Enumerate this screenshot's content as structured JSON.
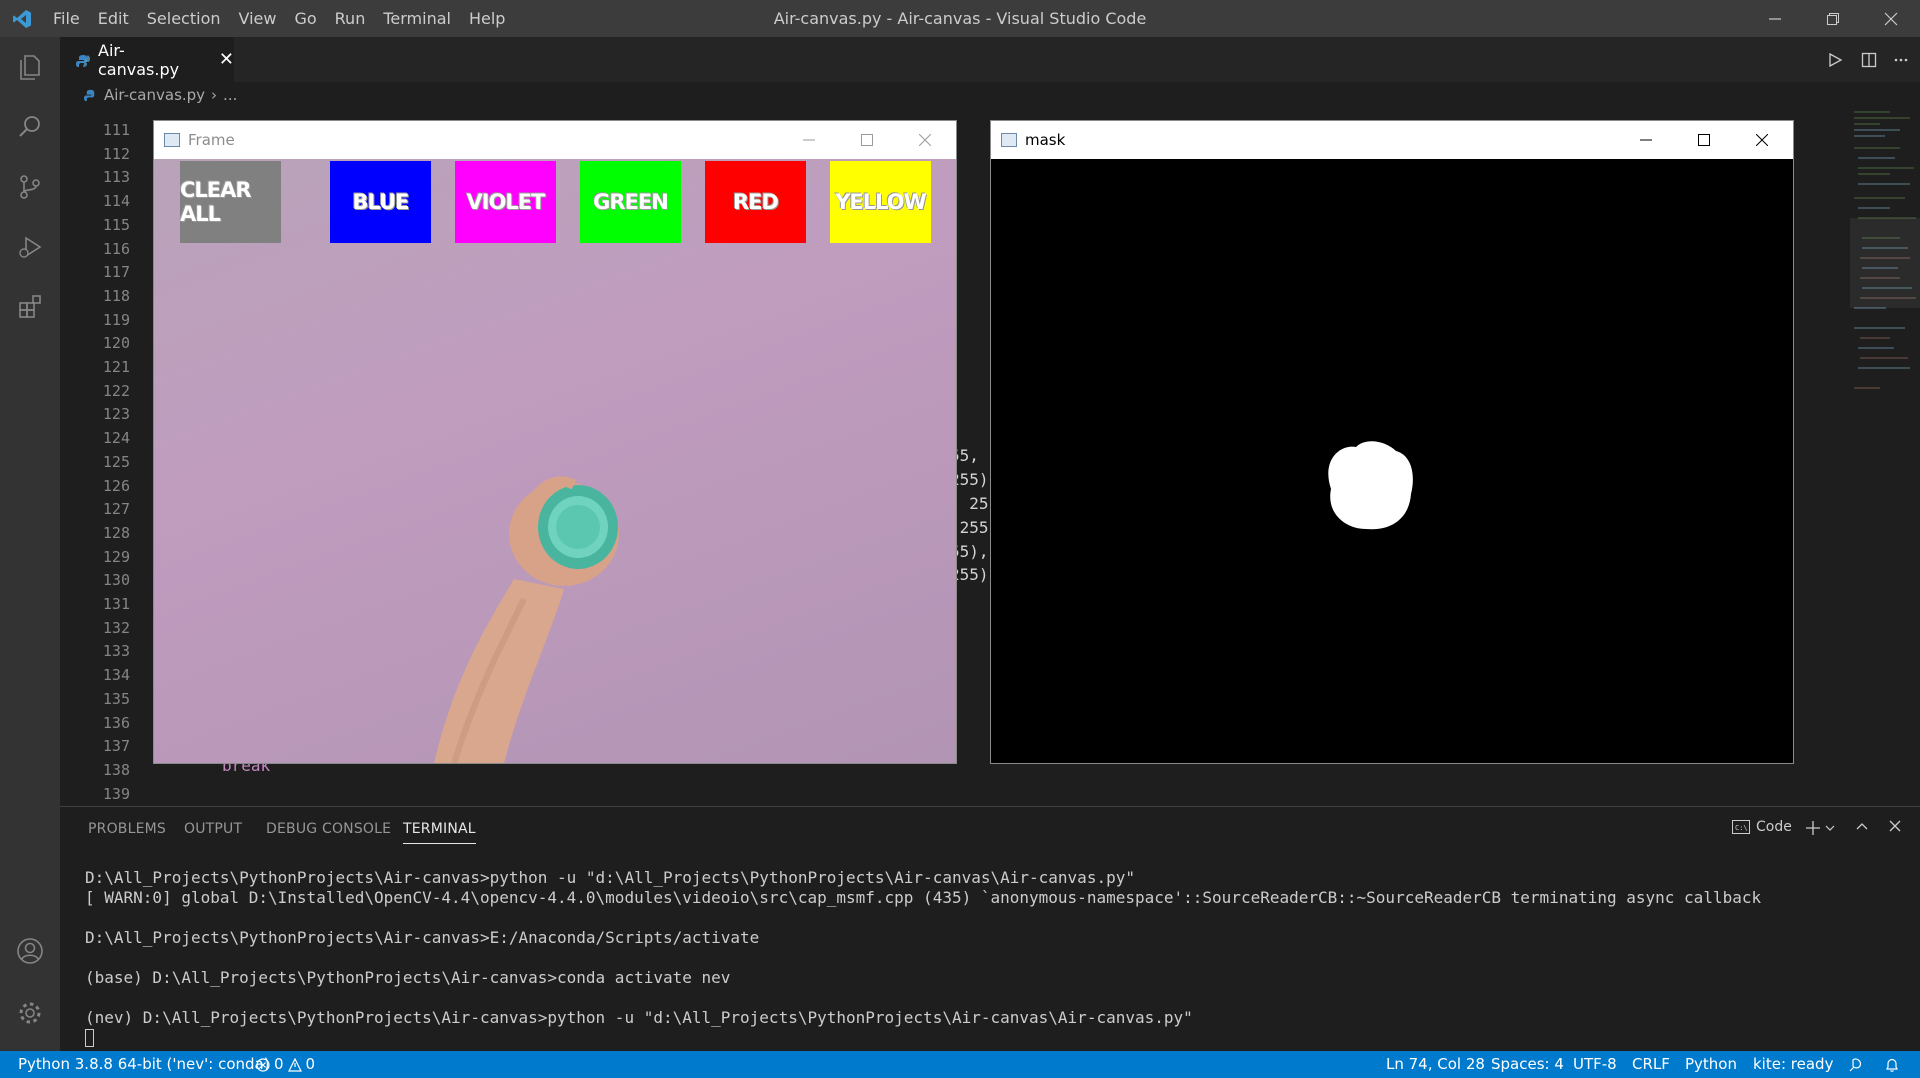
{
  "titlebar": {
    "menu": [
      "File",
      "Edit",
      "Selection",
      "View",
      "Go",
      "Run",
      "Terminal",
      "Help"
    ],
    "title": "Air-canvas.py - Air-canvas - Visual Studio Code"
  },
  "tabs": {
    "active_label": "Air-canvas.py"
  },
  "breadcrumb": {
    "file": "Air-canvas.py",
    "rest": "..."
  },
  "editor": {
    "line_numbers": [
      "111",
      "112",
      "113",
      "114",
      "115",
      "116",
      "117",
      "118",
      "119",
      "120",
      "121",
      "122",
      "123",
      "124",
      "125",
      "126",
      "127",
      "128",
      "129",
      "130",
      "131",
      "132",
      "133",
      "134",
      "135",
      "136",
      "137",
      "138",
      "139"
    ],
    "visible_fragments": [
      "55,",
      "255)",
      ", 25",
      " 255",
      "55),",
      "255)",
      "break"
    ]
  },
  "frame_window": {
    "title": "Frame",
    "buttons": [
      {
        "label": "CLEAR ALL",
        "color": "#808080"
      },
      {
        "label": "BLUE",
        "color": "#0000ff"
      },
      {
        "label": "VIOLET",
        "color": "#ff00ff"
      },
      {
        "label": "GREEN",
        "color": "#00ff00"
      },
      {
        "label": "RED",
        "color": "#ff0000"
      },
      {
        "label": "YELLOW",
        "color": "#ffff00"
      }
    ]
  },
  "mask_window": {
    "title": "mask"
  },
  "panel": {
    "tabs": [
      "PROBLEMS",
      "OUTPUT",
      "DEBUG CONSOLE",
      "TERMINAL"
    ],
    "terminal_selector": "Code",
    "terminal_lines": [
      "D:\\All_Projects\\PythonProjects\\Air-canvas>python -u \"d:\\All_Projects\\PythonProjects\\Air-canvas\\Air-canvas.py\"",
      "[ WARN:0] global D:\\Installed\\OpenCV-4.4\\opencv-4.4.0\\modules\\videoio\\src\\cap_msmf.cpp (435) `anonymous-namespace'::SourceReaderCB::~SourceReaderCB terminating async callback",
      "",
      "D:\\All_Projects\\PythonProjects\\Air-canvas>E:/Anaconda/Scripts/activate",
      "",
      "(base) D:\\All_Projects\\PythonProjects\\Air-canvas>conda activate nev",
      "",
      "(nev) D:\\All_Projects\\PythonProjects\\Air-canvas>python -u \"d:\\All_Projects\\PythonProjects\\Air-canvas\\Air-canvas.py\""
    ]
  },
  "statusbar": {
    "interpreter": "Python 3.8.8 64-bit ('nev': conda)",
    "errors": "0",
    "warnings": "0",
    "position": "Ln 74, Col 28",
    "spaces": "Spaces: 4",
    "encoding": "UTF-8",
    "eol": "CRLF",
    "language": "Python",
    "kite": "kite: ready",
    "accent": "#007acc"
  }
}
